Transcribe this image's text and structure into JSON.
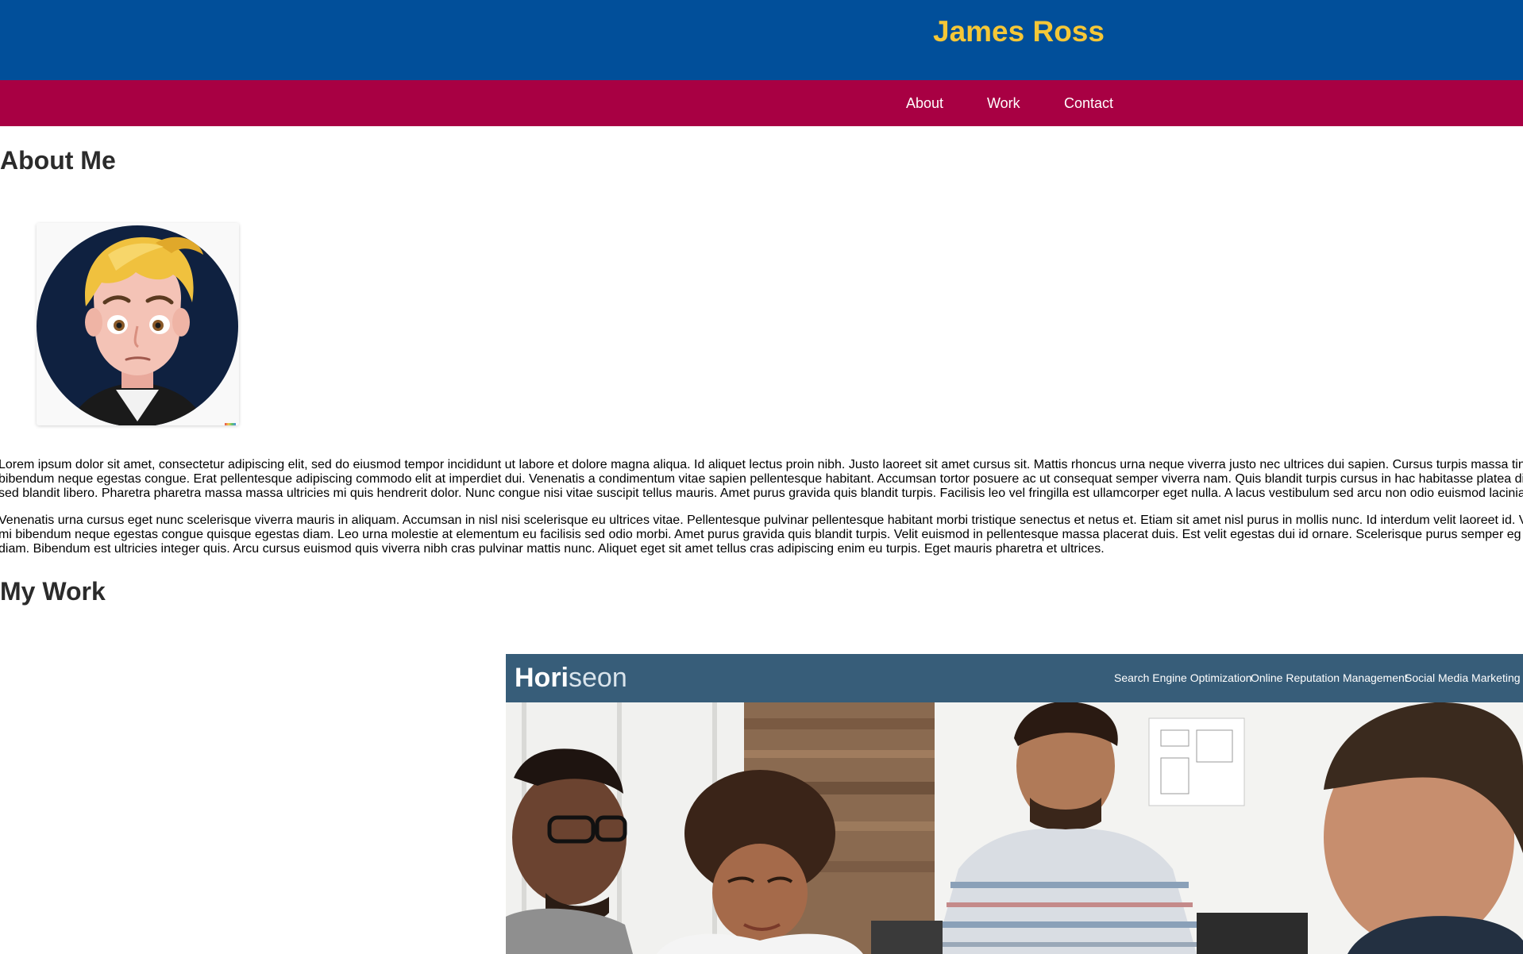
{
  "header": {
    "title": "James Ross"
  },
  "nav": {
    "items": [
      {
        "label": "About"
      },
      {
        "label": "Work"
      },
      {
        "label": "Contact"
      }
    ]
  },
  "about": {
    "heading": "About Me",
    "paragraphs": [
      [
        "Lorem ipsum dolor sit amet, consectetur adipiscing elit, sed do eiusmod tempor incididunt ut labore et dolore magna aliqua. Id aliquet lectus proin nibh. Justo laoreet sit amet cursus sit. Mattis rhoncus urna neque viverra justo nec ultrices dui sapien. Cursus turpis massa tin",
        "bibendum neque egestas congue. Erat pellentesque adipiscing commodo elit at imperdiet dui. Venenatis a condimentum vitae sapien pellentesque habitant. Accumsan tortor posuere ac ut consequat semper viverra nam. Quis blandit turpis cursus in hac habitasse platea di",
        "sed blandit libero. Pharetra pharetra massa massa ultricies mi quis hendrerit dolor. Nunc congue nisi vitae suscipit tellus mauris. Amet purus gravida quis blandit turpis. Facilisis leo vel fringilla est ullamcorper eget nulla. A lacus vestibulum sed arcu non odio euismod lacinia"
      ],
      [
        "Venenatis urna cursus eget nunc scelerisque viverra mauris in aliquam. Accumsan in nisl nisi scelerisque eu ultrices vitae. Pellentesque pulvinar pellentesque habitant morbi tristique senectus et netus et. Etiam sit amet nisl purus in mollis nunc. Id interdum velit laoreet id. V",
        "mi bibendum neque egestas congue quisque egestas diam. Leo urna molestie at elementum eu facilisis sed odio morbi. Amet purus gravida quis blandit turpis. Velit euismod in pellentesque massa placerat duis. Est velit egestas dui id ornare. Scelerisque purus semper eg",
        "diam. Bibendum est ultricies integer quis. Arcu cursus euismod quis viverra nibh cras pulvinar mattis nunc. Aliquet eget sit amet tellus cras adipiscing enim eu turpis. Eget mauris pharetra et ultrices."
      ]
    ]
  },
  "work": {
    "heading": "My Work",
    "project": {
      "brand_main": "Hori",
      "brand_accent": "seon",
      "nav": [
        "Search Engine Optimization",
        "Online Reputation Management",
        "Social Media Marketing"
      ]
    }
  },
  "colors": {
    "header_bg": "#014f9a",
    "title_color": "#f5c737",
    "nav_bg": "#a80043",
    "nav_text": "#ffffff",
    "project_header_bg": "#375d79"
  },
  "icons": {
    "avatar": "cartoon-avatar-portrait",
    "project_preview": "team-meeting-photo"
  }
}
